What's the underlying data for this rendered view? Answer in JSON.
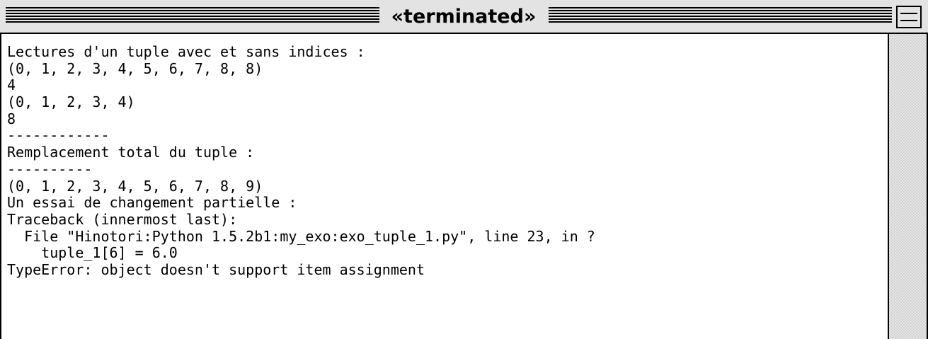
{
  "window": {
    "title": "«terminated»"
  },
  "console": {
    "lines": [
      "Lectures d'un tuple avec et sans indices :",
      "(0, 1, 2, 3, 4, 5, 6, 7, 8, 8)",
      "4",
      "(0, 1, 2, 3, 4)",
      "8",
      "------------",
      "Remplacement total du tuple :",
      "----------",
      "(0, 1, 2, 3, 4, 5, 6, 7, 8, 9)",
      "Un essai de changement partielle :",
      "Traceback (innermost last):",
      "  File \"Hinotori:Python 1.5.2b1:my_exo:exo_tuple_1.py\", line 23, in ?",
      "    tuple_1[6] = 6.0",
      "TypeError: object doesn't support item assignment"
    ]
  },
  "icons": {
    "zoom": "zoom-box-icon"
  }
}
